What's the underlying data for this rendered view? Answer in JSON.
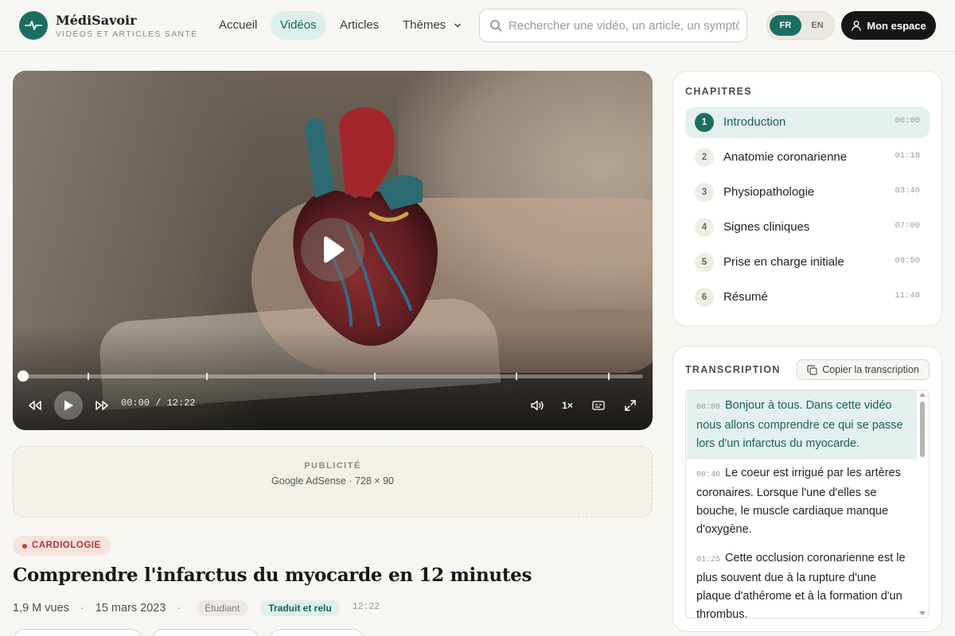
{
  "brand": {
    "name": "MédiSavoir",
    "tagline": "VIDÉOS ET ARTICLES SANTÉ"
  },
  "nav": [
    {
      "label": "Accueil"
    },
    {
      "label": "Vidéos",
      "active": true
    },
    {
      "label": "Articles"
    },
    {
      "label": "Thèmes",
      "icon": "chevron-down-icon"
    }
  ],
  "search": {
    "placeholder": "Rechercher une vidéo, un article, un symptôme",
    "icon": "search-icon"
  },
  "language": {
    "options": [
      "FR",
      "EN"
    ],
    "selected": "FR"
  },
  "account": {
    "label": "Mon espace",
    "icon": "user-icon"
  },
  "player": {
    "time_display": "00:00 / 12:22",
    "speed": "1×",
    "progress": 0,
    "chapter_marks_seconds": [
      0,
      78,
      220,
      420,
      590,
      700
    ],
    "duration_seconds": 742,
    "controls": [
      "rewind-icon",
      "play-icon",
      "forward-icon",
      "volume-icon",
      "speed",
      "captions-icon",
      "fullscreen-icon"
    ]
  },
  "ad": {
    "label": "PUBLICITÉ",
    "size": "Google AdSense · 728 × 90"
  },
  "video": {
    "category": "CARDIOLOGIE",
    "title": "Comprendre l'infarctus du myocarde en 12 minutes",
    "views": "1,9 M vues",
    "date": "15 mars 2023",
    "level": "Étudiant",
    "status": "Traduit et relu",
    "duration": "12:22"
  },
  "chapters": {
    "title": "CHAPITRES",
    "items": [
      {
        "n": "1",
        "label": "Introduction",
        "time": "00:00",
        "active": true
      },
      {
        "n": "2",
        "label": "Anatomie coronarienne",
        "time": "01:18"
      },
      {
        "n": "3",
        "label": "Physiopathologie",
        "time": "03:40"
      },
      {
        "n": "4",
        "label": "Signes cliniques",
        "time": "07:00"
      },
      {
        "n": "5",
        "label": "Prise en charge initiale",
        "time": "09:50"
      },
      {
        "n": "6",
        "label": "Résumé",
        "time": "11:40"
      }
    ]
  },
  "transcript": {
    "title": "TRANSCRIPTION",
    "copy_label": "Copier la transcription",
    "segments": [
      {
        "time": "00:00",
        "text": "Bonjour à tous. Dans cette vidéo nous allons comprendre ce qui se passe lors d'un infarctus du myocarde.",
        "active": true
      },
      {
        "time": "00:40",
        "text": "Le coeur est irrigué par les artères coronaires. Lorsque l'une d'elles se bouche, le muscle cardiaque manque d'oxygène."
      },
      {
        "time": "01:25",
        "text": "Cette occlusion coronarienne est le plus souvent due à la rupture d'une plaque d'athérome et à la formation d'un thrombus."
      }
    ]
  },
  "colors": {
    "accent": "#1c6e63",
    "accent_soft": "#dcefeb",
    "category": "#b4362d",
    "background": "#f8f6f2"
  }
}
